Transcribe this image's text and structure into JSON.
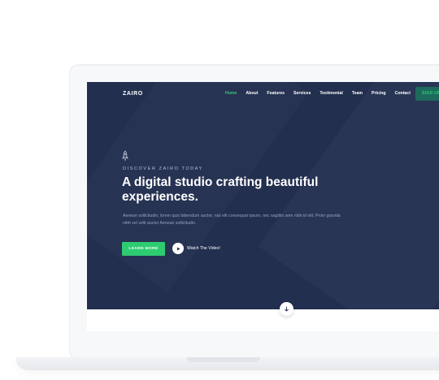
{
  "brand": {
    "logo": "ZAIRO"
  },
  "nav": {
    "items": [
      {
        "label": "Home",
        "active": true
      },
      {
        "label": "About",
        "active": false
      },
      {
        "label": "Features",
        "active": false
      },
      {
        "label": "Services",
        "active": false
      },
      {
        "label": "Testimonial",
        "active": false
      },
      {
        "label": "Team",
        "active": false
      },
      {
        "label": "Pricing",
        "active": false
      },
      {
        "label": "Contact",
        "active": false
      }
    ],
    "signup_label": "SIGN UP"
  },
  "hero": {
    "icon": "rocket-icon",
    "eyebrow": "DISCOVER ZAIRO TODAY",
    "headline": "A digital studio crafting beautiful experiences.",
    "description": "Aenean sollicitudin, lorem quis bibendum auctor, nisi elit consequat ipsum, nec sagittis sem nibh id elit. Proin gravida nibh vel velit auctor Aenean sollicitudin.",
    "primary_button": "LEARN MORE",
    "video_label": "Watch The Video!",
    "scroll_icon": "arrow-down-icon"
  },
  "colors": {
    "hero_bg": "#222f4f",
    "accent": "#2ecc71",
    "signup_bg": "#1e6a5d"
  }
}
